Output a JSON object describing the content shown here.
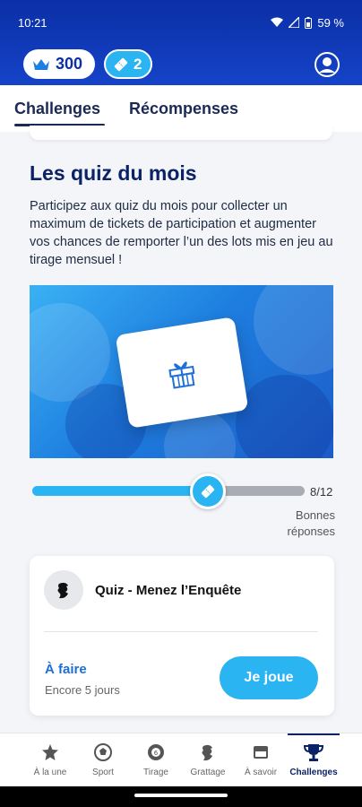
{
  "status_bar": {
    "time": "10:21",
    "battery": "59 %"
  },
  "header": {
    "points": "300",
    "tickets": "2"
  },
  "tabs": [
    {
      "label": "Challenges"
    },
    {
      "label": "Récompenses"
    }
  ],
  "section": {
    "title": "Les quiz du mois",
    "description": "Participez aux quiz du mois pour collecter un maximum de tickets de participation et augmenter vos chances de remporter l’un des lots mis en jeu au tirage mensuel !"
  },
  "progress": {
    "count": "8/12",
    "label": "Bonnes réponses",
    "value": 0.667
  },
  "quiz": {
    "title": "Quiz - Menez l’Enquête",
    "status": "À faire",
    "remaining": "Encore 5 jours",
    "button": "Je joue"
  },
  "nav": [
    {
      "label": "À la une",
      "icon": "star-icon"
    },
    {
      "label": "Sport",
      "icon": "ball-icon"
    },
    {
      "label": "Tirage",
      "icon": "lottery-ball-icon"
    },
    {
      "label": "Grattage",
      "icon": "scratch-icon"
    },
    {
      "label": "À savoir",
      "icon": "info-card-icon"
    },
    {
      "label": "Challenges",
      "icon": "trophy-icon"
    }
  ],
  "colors": {
    "primary": "#0b2fa6",
    "accent": "#2ab4f2",
    "navy": "#0b2366"
  }
}
